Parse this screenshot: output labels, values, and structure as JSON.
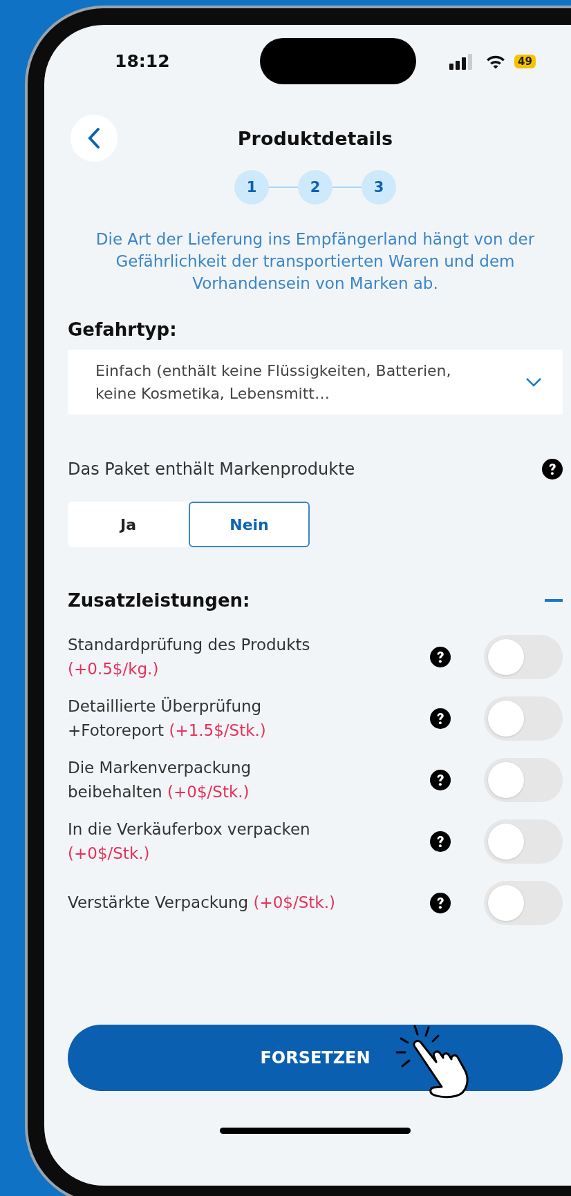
{
  "status_bar": {
    "time": "18:12",
    "battery": "49"
  },
  "header": {
    "title": "Produktdetails"
  },
  "steps": [
    {
      "label": "1"
    },
    {
      "label": "2"
    },
    {
      "label": "3"
    }
  ],
  "description": "Die Art der Lieferung ins Empfängerland hängt von der Gefährlichkeit der transportierten Waren und dem Vorhandensein von Marken ab.",
  "hazard": {
    "label": "Gefahrtyp:",
    "value": "Einfach (enthält keine Flüssigkeiten, Batterien, keine Kosmetika, Lebensmitt…"
  },
  "brand": {
    "question": "Das Paket enthält Markenprodukte",
    "options": [
      {
        "label": "Ja",
        "selected": false
      },
      {
        "label": "Nein",
        "selected": true
      }
    ]
  },
  "services": {
    "title": "Zusatzleistungen:",
    "expanded": true,
    "items": [
      {
        "label": "Standardprüfung des Produkts",
        "price": "(+0.5$/kg.)",
        "on": false
      },
      {
        "label": "Detaillierte Überprüfung +Fotoreport",
        "price": "(+1.5$/Stk.)",
        "on": false
      },
      {
        "label": "Die Markenverpackung beibehalten",
        "price": "(+0$/Stk.)",
        "on": false
      },
      {
        "label": "In die Verkäuferbox verpacken",
        "price": "(+0$/Stk.)",
        "on": false
      },
      {
        "label": "Verstärkte Verpackung",
        "price": "(+0$/Stk.)",
        "on": false
      }
    ]
  },
  "continue_button": "FORSETZEN"
}
